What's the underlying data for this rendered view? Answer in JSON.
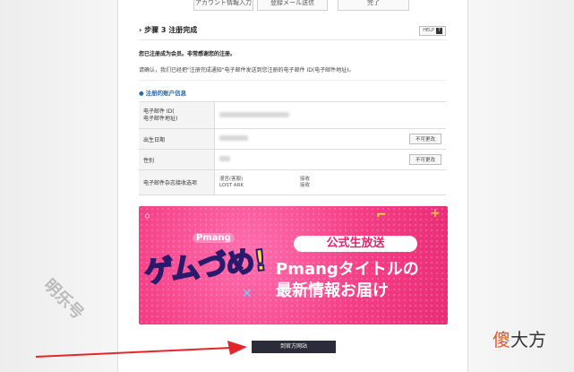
{
  "steps": [
    "アカウント情報入力",
    "登録メール送信",
    "完了"
  ],
  "section": {
    "title": "步骤 3 注册完成",
    "help_label": "HELP",
    "help_icon": "?"
  },
  "notice": {
    "line1": "您已注册成为会员。非常感谢您的注册。",
    "line2": "请确认，我们已经把\"注册完成通知\"电子邮件发送到您注册的电子邮件 ID(电子邮件地址)。"
  },
  "account_info_title": "注册的账户信息",
  "rows": [
    {
      "label": "电子邮件 ID(\n电子邮件地址)",
      "has_button": false
    },
    {
      "label": "出生日期",
      "has_button": true
    },
    {
      "label": "性别",
      "has_button": true
    },
    {
      "label": "电子邮件杂志接收选项",
      "has_button": false
    }
  ],
  "change_button_label": "不可更改",
  "mail_options": [
    {
      "name": "漫官(客服)",
      "status": "接收"
    },
    {
      "name": "LOST ARK",
      "status": "接收"
    }
  ],
  "banner": {
    "logo_small": "Pmang",
    "logo_big": "ゲムづめ!",
    "tag": "公式生放送",
    "line2": "Pmangタイトルの",
    "line3": "最新情報お届け"
  },
  "go_button_label": "到官方网站",
  "watermark_left": "明乐号",
  "watermark_right_first": "傻",
  "watermark_right_rest": "大方"
}
